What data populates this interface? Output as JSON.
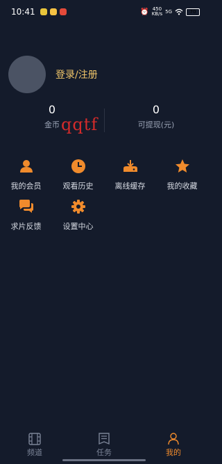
{
  "status_bar": {
    "time": "10:41",
    "net_speed": "450",
    "net_unit": "KB/s",
    "network": "5G",
    "battery": "70"
  },
  "profile": {
    "login_label": "登录/注册"
  },
  "stats": {
    "coins_value": "0",
    "coins_label": "金币",
    "withdraw_value": "0",
    "withdraw_label": "可提现(元)"
  },
  "overlay_text": "qqtf",
  "menu": {
    "row1": [
      {
        "label": "我的会员",
        "icon": "user-icon"
      },
      {
        "label": "观看历史",
        "icon": "clock-icon"
      },
      {
        "label": "离线缓存",
        "icon": "download-icon"
      },
      {
        "label": "我的收藏",
        "icon": "star-icon"
      }
    ],
    "row2": [
      {
        "label": "求片反馈",
        "icon": "chat-icon"
      },
      {
        "label": "设置中心",
        "icon": "gear-icon"
      }
    ]
  },
  "tabs": [
    {
      "label": "频道",
      "icon": "film-icon",
      "active": false
    },
    {
      "label": "任务",
      "icon": "task-icon",
      "active": false
    },
    {
      "label": "我的",
      "icon": "profile-icon",
      "active": true
    }
  ],
  "colors": {
    "background": "#141b2b",
    "accent": "#f08b2c",
    "login": "#f1c66a",
    "inactive": "#7b8497"
  }
}
